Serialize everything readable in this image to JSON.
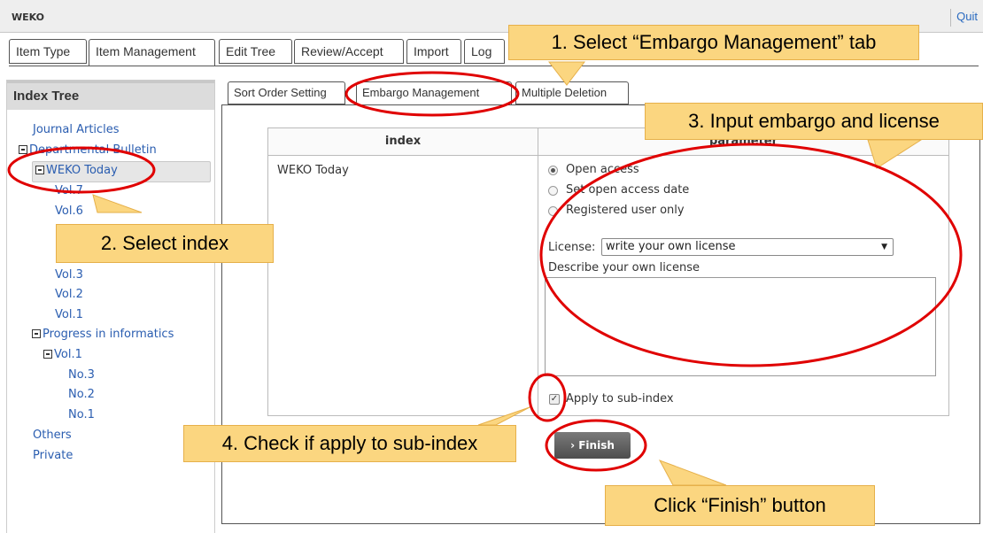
{
  "app": {
    "title": "WEKO",
    "quit_label": "Quit"
  },
  "main_tabs": [
    {
      "label": "Item Type"
    },
    {
      "label": "Item Management"
    },
    {
      "label": "Edit Tree"
    },
    {
      "label": "Review/Accept"
    },
    {
      "label": "Import"
    },
    {
      "label": "Log"
    }
  ],
  "sidebar": {
    "title": "Index Tree",
    "items": [
      {
        "label": "Journal Articles"
      },
      {
        "label": "Departmental Bulletin"
      },
      {
        "label": "WEKO Today"
      },
      {
        "label": "Vol.7"
      },
      {
        "label": "Vol.6"
      },
      {
        "label": "Vol.3"
      },
      {
        "label": "Vol.2"
      },
      {
        "label": "Vol.1"
      },
      {
        "label": "Progress in informatics"
      },
      {
        "label": "Vol.1"
      },
      {
        "label": "No.3"
      },
      {
        "label": "No.2"
      },
      {
        "label": "No.1"
      },
      {
        "label": "Others"
      },
      {
        "label": "Private"
      }
    ]
  },
  "sub_tabs": [
    {
      "label": "Sort Order Setting"
    },
    {
      "label": "Embargo Management"
    },
    {
      "label": "Multiple Deletion"
    }
  ],
  "grid": {
    "col_index": "index",
    "col_parameter": "parameter",
    "row_index_name": "WEKO Today",
    "access_options": [
      {
        "label": "Open access",
        "checked": true
      },
      {
        "label": "Set open access date",
        "checked": false
      },
      {
        "label": "Registered user only",
        "checked": false
      }
    ],
    "license_label": "License:",
    "license_selected": "write your own license",
    "describe_label": "Describe your own license",
    "apply_sub_label": "Apply to sub-index",
    "apply_sub_checked": true,
    "finish_label": "Finish"
  },
  "callouts": {
    "step1": "1. Select “Embargo Management” tab",
    "step2": "2. Select index",
    "step3": "3. Input embargo and license",
    "step4": "4. Check if apply to sub-index",
    "step5": "Click “Finish” button"
  },
  "colors": {
    "highlight_red": "#e00000",
    "callout_fill": "#fbd680",
    "link_blue": "#2a5db0"
  }
}
